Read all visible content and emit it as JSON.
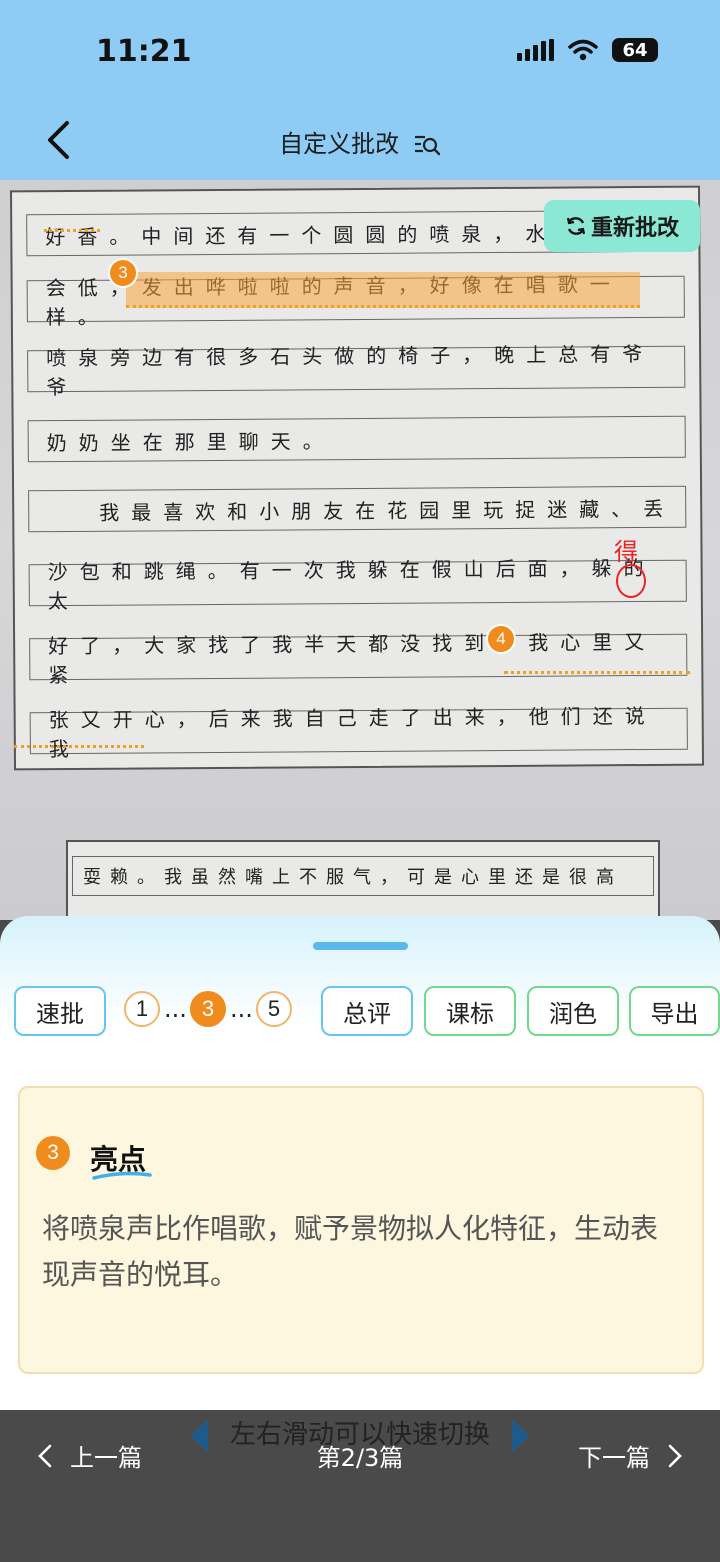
{
  "status_bar": {
    "time": "11:21",
    "battery": "64"
  },
  "header": {
    "title": "自定义批改"
  },
  "essay": {
    "rows": [
      "好香。中间还有一个圆圆的喷泉，水",
      "会低，发出哗啦啦的声音，好像在唱歌一样。",
      "喷泉旁边有很多石头做的椅子，晚上总有爷爷",
      "奶奶坐在那里聊天。",
      "我最喜欢和小朋友在花园里玩捉迷藏、丢",
      "沙包和跳绳。有一次我躲在假山后面，躲的太",
      "好了，大家找了我半天都没找到，我心里又紧",
      "张又开心，后来我自己走了出来，他们还说我"
    ],
    "next_page_row": "耍赖。我虽然嘴上不服气，可是心里还是很高",
    "correction": "得",
    "badges": [
      "3",
      "4"
    ],
    "regrade_label": "重新批改"
  },
  "toolbar": {
    "quick_label": "速批",
    "pages": [
      "1",
      "3",
      "5"
    ],
    "ellipsis": "...",
    "summary_label": "总评",
    "standard_label": "课标",
    "polish_label": "润色",
    "export_label": "导出"
  },
  "card": {
    "badge": "3",
    "title": "亮点",
    "text": "将喷泉声比作唱歌，赋予景物拟人化特征，生动表现声音的悦耳。"
  },
  "bottom": {
    "hint": "左右滑动可以快速切换",
    "prev_label": "上一篇",
    "next_label": "下一篇",
    "page_info": "第2/3篇"
  },
  "colors": {
    "header_bg": "#8fccf5",
    "accent_orange": "#f08b1e",
    "accent_blue": "#66c6f2",
    "accent_green": "#72d88c",
    "regrade_bg": "#8be8d4"
  }
}
